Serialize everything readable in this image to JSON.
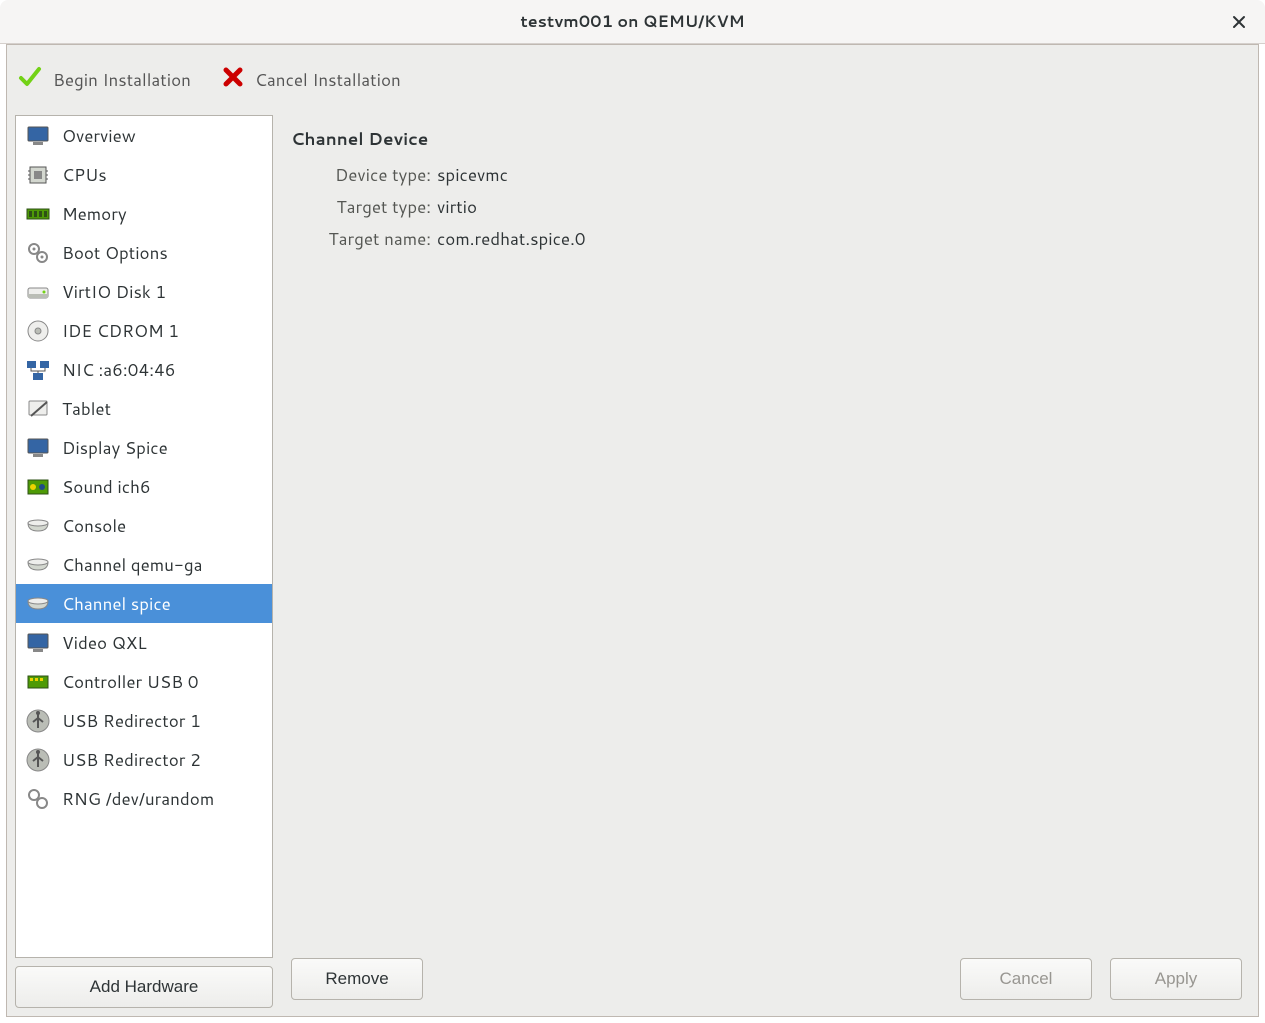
{
  "titlebar": {
    "title": "testvm001 on QEMU/KVM"
  },
  "toolbar": {
    "begin_label": "Begin Installation",
    "cancel_label": "Cancel Installation"
  },
  "sidebar": {
    "items": [
      {
        "label": "Overview"
      },
      {
        "label": "CPUs"
      },
      {
        "label": "Memory"
      },
      {
        "label": "Boot Options"
      },
      {
        "label": "VirtIO Disk 1"
      },
      {
        "label": "IDE CDROM 1"
      },
      {
        "label": "NIC :a6:04:46"
      },
      {
        "label": "Tablet"
      },
      {
        "label": "Display Spice"
      },
      {
        "label": "Sound ich6"
      },
      {
        "label": "Console"
      },
      {
        "label": "Channel qemu-ga"
      },
      {
        "label": "Channel spice"
      },
      {
        "label": "Video QXL"
      },
      {
        "label": "Controller USB 0"
      },
      {
        "label": "USB Redirector 1"
      },
      {
        "label": "USB Redirector 2"
      },
      {
        "label": "RNG /dev/urandom"
      }
    ],
    "selected_index": 12,
    "add_hw_label": "Add Hardware"
  },
  "detail": {
    "section_title": "Channel Device",
    "props": {
      "device_type_label": "Device type:",
      "device_type_value": "spicevmc",
      "target_type_label": "Target type:",
      "target_type_value": "virtio",
      "target_name_label": "Target name:",
      "target_name_value": "com.redhat.spice.0"
    }
  },
  "buttons": {
    "remove": "Remove",
    "cancel": "Cancel",
    "apply": "Apply"
  }
}
